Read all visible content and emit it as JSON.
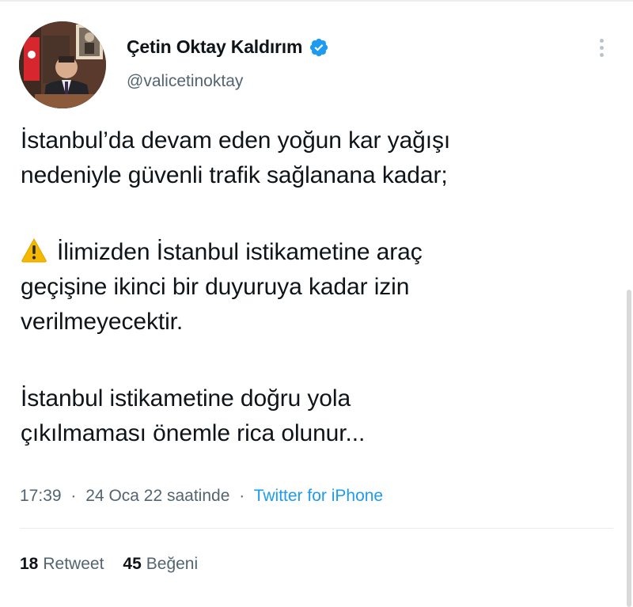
{
  "author": {
    "display_name": "Çetin Oktay Kaldırım",
    "handle": "@valicetinoktay",
    "verified": true
  },
  "tweet": {
    "paragraphs": [
      {
        "lines": [
          "İstanbul’da devam eden yoğun kar yağışı",
          "nedeniyle güvenli trafik sağlanana kadar;"
        ]
      },
      {
        "icon": "warning-icon",
        "lines": [
          "İlimizden İstanbul istikametine araç",
          "geçişine ikinci bir duyuruya kadar izin",
          "verilmeyecektir."
        ]
      },
      {
        "lines": [
          "İstanbul istikametine doğru yola",
          "çıkılmaması önemle rica olunur..."
        ]
      }
    ]
  },
  "meta": {
    "time": "17:39",
    "date": "24 Oca 22 saatinde",
    "separator": "·",
    "source": "Twitter for iPhone"
  },
  "stats": {
    "retweets_count": "18",
    "retweets_label": "Retweet",
    "likes_count": "45",
    "likes_label": "Beğeni"
  },
  "colors": {
    "text": "#0f1419",
    "secondary_text": "#536471",
    "link": "#1d9bf0",
    "verified_badge": "#1d9bf0",
    "warning_sign": "#f5b800"
  },
  "icons": {
    "verified": "verified-badge-icon",
    "more": "more-vertical-icon",
    "warning": "warning-icon"
  }
}
